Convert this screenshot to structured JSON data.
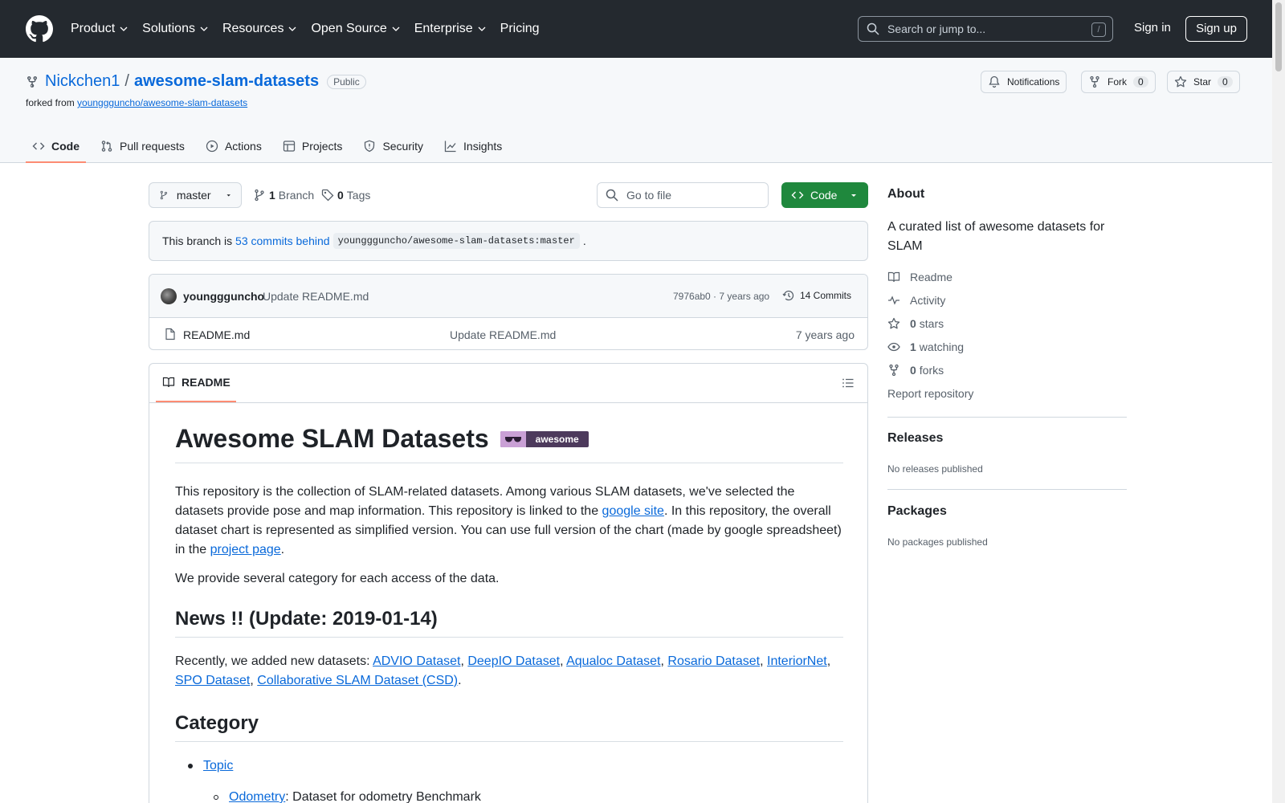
{
  "header": {
    "nav": [
      "Product",
      "Solutions",
      "Resources",
      "Open Source",
      "Enterprise",
      "Pricing"
    ],
    "search_placeholder": "Search or jump to...",
    "search_shortcut": "/",
    "sign_in": "Sign in",
    "sign_up": "Sign up"
  },
  "repo": {
    "owner": "Nickchen1",
    "separator": "/",
    "name": "awesome-slam-datasets",
    "visibility": "Public",
    "forked_from_label": "forked from",
    "forked_from": "younggguncho/awesome-slam-datasets",
    "notifications": "Notifications",
    "fork": "Fork",
    "fork_count": "0",
    "star": "Star",
    "star_count": "0"
  },
  "tabs": [
    "Code",
    "Pull requests",
    "Actions",
    "Projects",
    "Security",
    "Insights"
  ],
  "toolbar": {
    "branch": "master",
    "branches_count": "1",
    "branches_label": "Branch",
    "tags_count": "0",
    "tags_label": "Tags",
    "goto_placeholder": "Go to file",
    "code_button": "Code"
  },
  "behind": {
    "prefix": "This branch is",
    "link": "53 commits behind",
    "ref": "younggguncho/awesome-slam-datasets:master",
    "suffix": "."
  },
  "commit": {
    "author": "younggguncho",
    "message": "Update README.md",
    "meta": "7976ab0 · 7 years ago",
    "count": "14 Commits"
  },
  "files": [
    {
      "name": "README.md",
      "message": "Update README.md",
      "time": "7 years ago"
    }
  ],
  "readme": {
    "tab": "README",
    "title": "Awesome SLAM Datasets",
    "badge_text": "awesome",
    "p1_a": "This repository is the collection of SLAM-related datasets. Among various SLAM datasets, we've selected the datasets provide pose and map information. This repository is linked to the ",
    "p1_link1": "google site",
    "p1_b": ". In this repository, the overall dataset chart is represented as simplified version. You can use full version of the chart (made by google spreadsheet) in the ",
    "p1_link2": "project page",
    "p1_c": ".",
    "p2": "We provide several category for each access of the data.",
    "news_title": "News !! (Update: 2019-01-14)",
    "news_prefix": "Recently, we added new datasets: ",
    "news_links": [
      "ADVIO Dataset",
      "DeepIO Dataset",
      "Aqualoc Dataset",
      "Rosario Dataset",
      "InteriorNet",
      "SPO Dataset",
      "Collaborative SLAM Dataset (CSD)"
    ],
    "category_title": "Category",
    "topic": "Topic",
    "odometry": "Odometry",
    "odometry_desc": ": Dataset for odometry Benchmark"
  },
  "sidebar": {
    "about": "About",
    "description": "A curated list of awesome datasets for SLAM",
    "readme": "Readme",
    "activity": "Activity",
    "stars_count": "0",
    "stars_label": "stars",
    "watching_count": "1",
    "watching_label": "watching",
    "forks_count": "0",
    "forks_label": "forks",
    "report": "Report repository",
    "releases": "Releases",
    "no_releases": "No releases published",
    "packages": "Packages",
    "no_packages": "No packages published"
  }
}
